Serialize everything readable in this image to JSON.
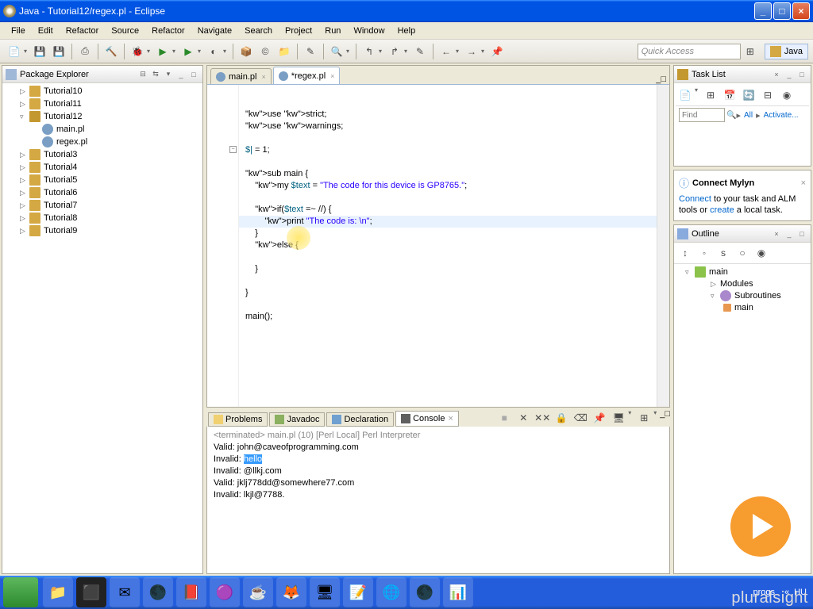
{
  "window": {
    "title": "Java - Tutorial12/regex.pl - Eclipse"
  },
  "menu": [
    "File",
    "Edit",
    "Refactor",
    "Source",
    "Refactor",
    "Navigate",
    "Search",
    "Project",
    "Run",
    "Window",
    "Help"
  ],
  "quickaccess": "Quick Access",
  "perspective": "Java",
  "packageExplorer": {
    "title": "Package Explorer",
    "items": [
      {
        "name": "Tutorial10",
        "expanded": false
      },
      {
        "name": "Tutorial11",
        "expanded": false
      },
      {
        "name": "Tutorial12",
        "expanded": true,
        "children": [
          {
            "name": "main.pl",
            "type": "perl"
          },
          {
            "name": "regex.pl",
            "type": "perl"
          }
        ]
      },
      {
        "name": "Tutorial3",
        "expanded": false
      },
      {
        "name": "Tutorial4",
        "expanded": false
      },
      {
        "name": "Tutorial5",
        "expanded": false
      },
      {
        "name": "Tutorial6",
        "expanded": false
      },
      {
        "name": "Tutorial7",
        "expanded": false
      },
      {
        "name": "Tutorial8",
        "expanded": false
      },
      {
        "name": "Tutorial9",
        "expanded": false
      }
    ]
  },
  "editor": {
    "tabs": [
      {
        "name": "main.pl",
        "active": false
      },
      {
        "name": "*regex.pl",
        "active": true
      }
    ],
    "lines": [
      "use strict;",
      "use warnings;",
      "",
      "$| = 1;",
      "",
      "sub main {",
      "    my $text = \"The code for this device is GP8765.\";",
      "",
      "    if($text =~ //) {",
      "        print \"The code is: \\n\";",
      "    }",
      "    else {",
      "        ",
      "    }",
      "",
      "}",
      "",
      "main();"
    ]
  },
  "tasklist": {
    "title": "Task List"
  },
  "find": {
    "label": "Find",
    "all": "All",
    "activate": "Activate..."
  },
  "mylyn": {
    "title": "Connect Mylyn",
    "text1": " to your task and ALM tools or ",
    "connect": "Connect",
    "create": "create",
    "text2": " a local task."
  },
  "outline": {
    "title": "Outline",
    "root": "main",
    "modules": "Modules",
    "subroutines": "Subroutines",
    "sub_main": "main"
  },
  "bottomTabs": [
    "Problems",
    "Javadoc",
    "Declaration",
    "Console"
  ],
  "console": {
    "header": "<terminated> main.pl (10) [Perl Local] Perl Interpreter",
    "lines": [
      {
        "t": "Valid: john@caveofprogramming.com"
      },
      {
        "t": "Invalid: ",
        "sel": "hello"
      },
      {
        "t": "Invalid: @llkj.com"
      },
      {
        "t": "Valid: jklj778dd@somewhere77.com"
      },
      {
        "t": "Invalid: lkjl@7788."
      }
    ]
  },
  "taskbar_tray": {
    "lang": "HU",
    "project": "progs"
  },
  "overlay": {
    "logo": "pluralsight"
  }
}
